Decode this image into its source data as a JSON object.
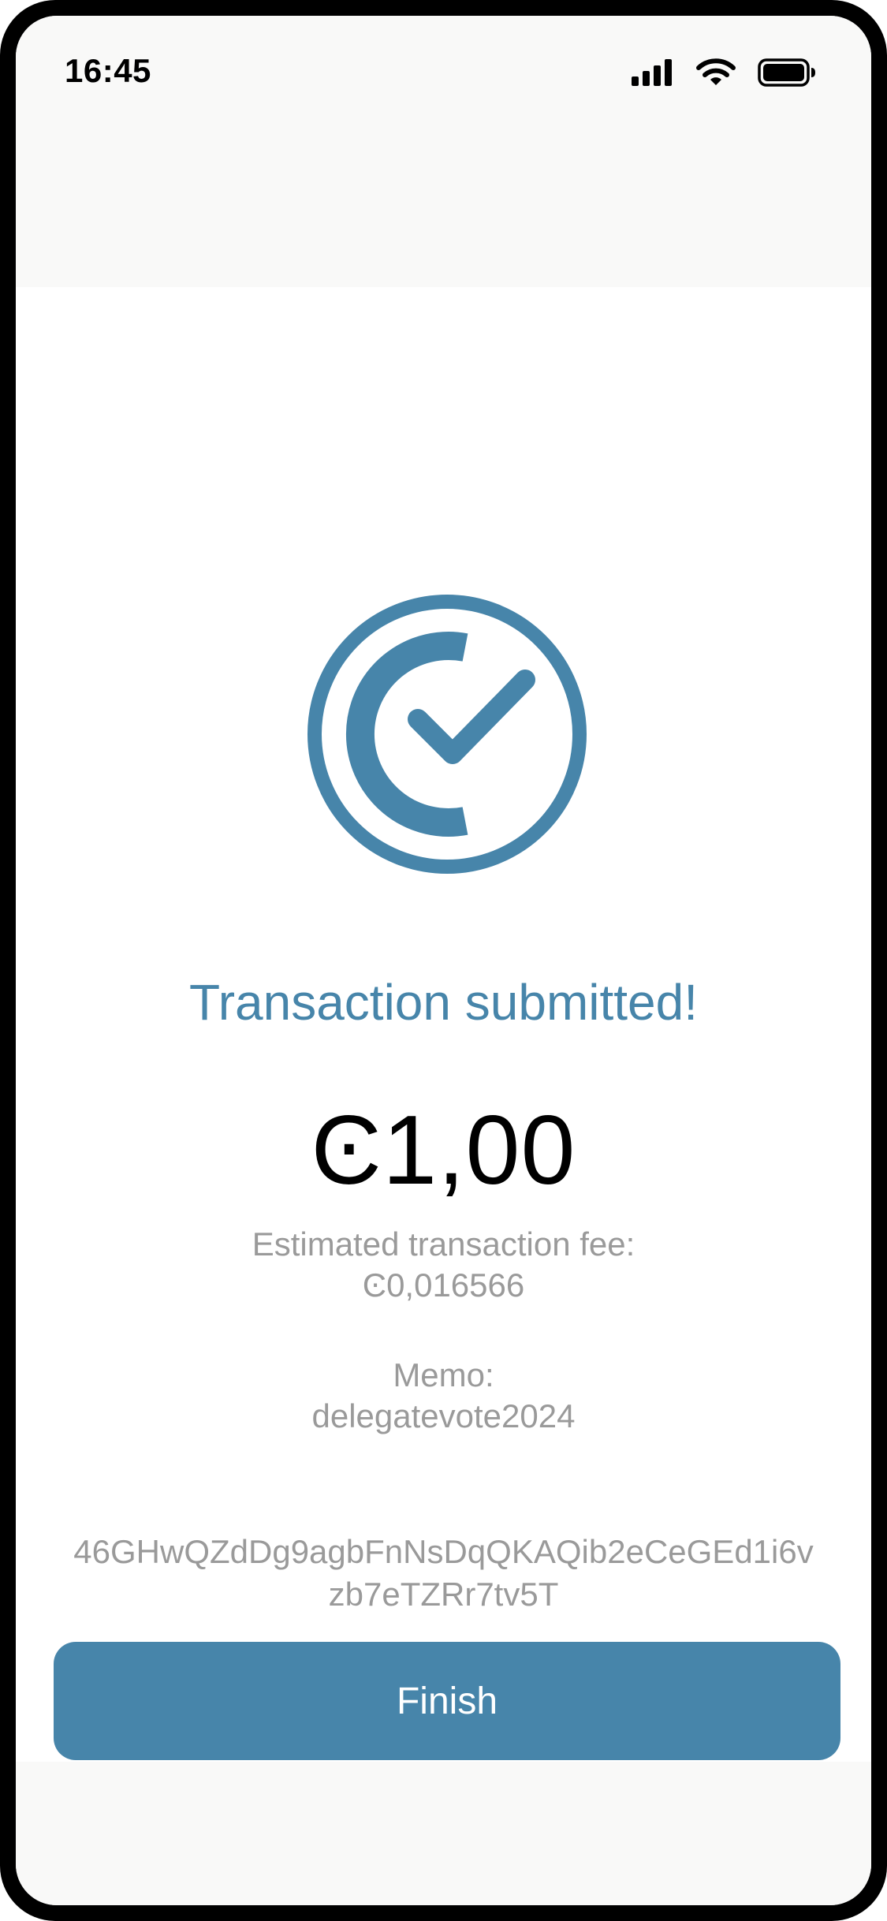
{
  "status_bar": {
    "time": "16:45"
  },
  "result": {
    "title": "Transaction submitted!",
    "amount": "Ͼ1,00",
    "fee_label": "Estimated transaction fee:",
    "fee_value": "Ͼ0,016566",
    "memo_label": "Memo:",
    "memo_value": "delegatevote2024",
    "tx_hash_line1": "46GHwQZdDg9agbFnNsDqQKAQib2eCeGEd1i6v",
    "tx_hash_line2": "zb7eTZRr7tv5T"
  },
  "actions": {
    "finish_label": "Finish"
  },
  "colors": {
    "accent": "#4785aa",
    "muted_text": "#9a9a9a",
    "background_header": "#f9f9f8"
  },
  "icons": {
    "success": "ccd-check-icon",
    "signal": "cellular-signal-icon",
    "wifi": "wifi-icon",
    "battery": "battery-icon"
  }
}
